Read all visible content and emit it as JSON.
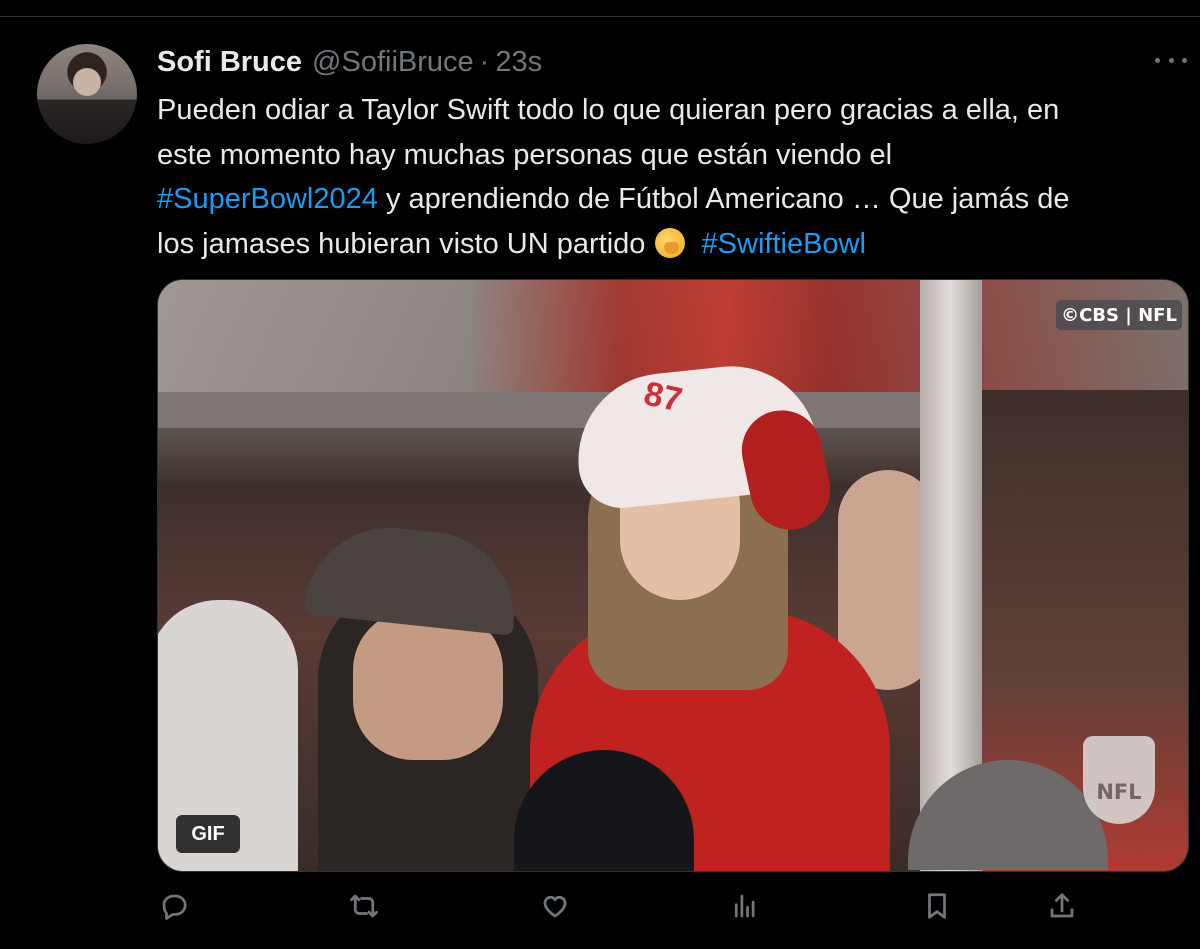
{
  "tweet": {
    "author_name": "Sofi Bruce",
    "handle": "@SofiiBruce",
    "separator": "·",
    "time": "23s",
    "text": {
      "line1": "Pueden odiar a Taylor Swift todo lo que quieran pero gracias a ella, en",
      "line2": "este momento hay muchas personas que están viendo el",
      "line3_hashtag": "#SuperBowl2024",
      "line3_text": " y aprendiendo de Fútbol Americano … Que jamás de",
      "line4_text": "los jamases hubieran visto UN partido",
      "line4_hashtag": "#SwiftieBowl"
    },
    "emoji": "face-with-hand-over-mouth"
  },
  "media": {
    "type": "GIF",
    "gif_label": "GIF",
    "broadcast_badge": "©CBS | NFL",
    "hat_number": "87",
    "nfl_logo_text": "NFL"
  },
  "actions": [
    {
      "name": "reply",
      "icon": "reply-icon"
    },
    {
      "name": "repost",
      "icon": "repost-icon"
    },
    {
      "name": "like",
      "icon": "heart-icon"
    },
    {
      "name": "views",
      "icon": "views-icon"
    },
    {
      "name": "bookmark",
      "icon": "bookmark-icon"
    },
    {
      "name": "share",
      "icon": "share-icon"
    }
  ],
  "colors": {
    "background": "#000000",
    "text": "#e7e9ea",
    "secondary": "#71767b",
    "accent": "#1d9bf0"
  }
}
